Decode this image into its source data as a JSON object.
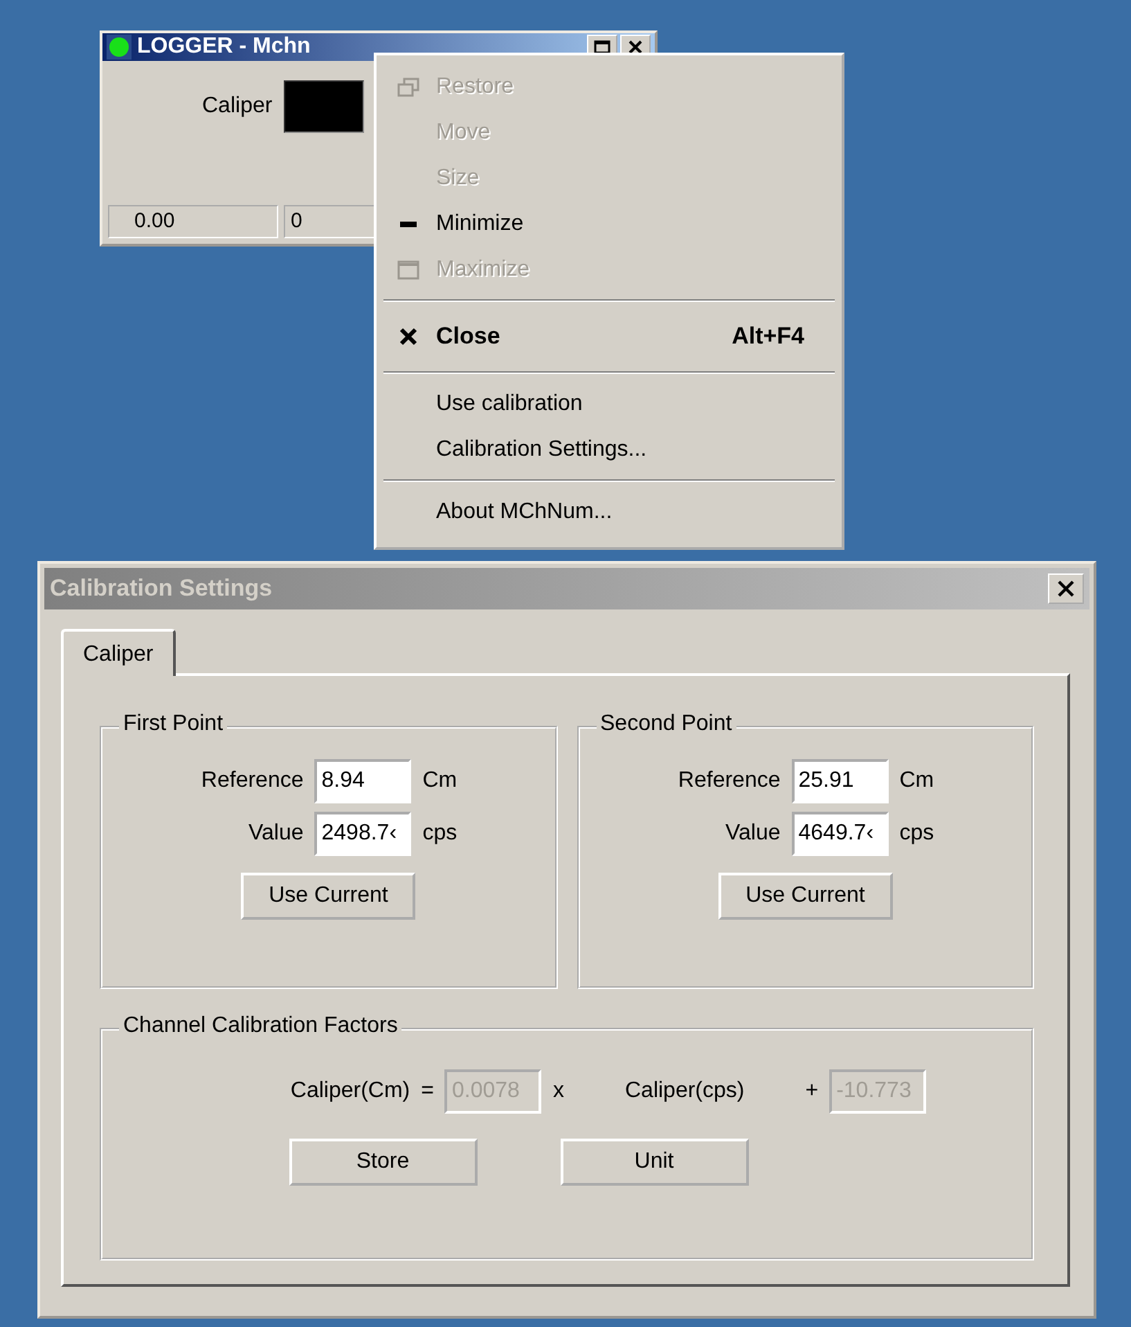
{
  "logger_window": {
    "title": "LOGGER - Mchn",
    "active": true,
    "label": "Caliper",
    "status_fields": [
      "0.00",
      "0"
    ]
  },
  "system_menu": {
    "items": [
      {
        "kind": "item",
        "label": "Restore",
        "disabled": true,
        "default": false
      },
      {
        "kind": "item",
        "label": "Move",
        "disabled": true,
        "default": false
      },
      {
        "kind": "item",
        "label": "Size",
        "disabled": true,
        "default": false
      },
      {
        "kind": "item",
        "label": "Minimize",
        "disabled": false,
        "default": false
      },
      {
        "kind": "item",
        "label": "Maximize",
        "disabled": true,
        "default": false
      },
      {
        "kind": "separator"
      },
      {
        "kind": "item",
        "label": "Close",
        "shortcut": "Alt+F4",
        "disabled": false,
        "default": true
      },
      {
        "kind": "separator"
      },
      {
        "kind": "item",
        "label": "Use calibration",
        "disabled": false,
        "default": false
      },
      {
        "kind": "item",
        "label": "Calibration Settings...",
        "disabled": false,
        "default": false
      },
      {
        "kind": "separator"
      },
      {
        "kind": "item",
        "label": "About MChNum...",
        "disabled": false,
        "default": false
      }
    ]
  },
  "calibration_window": {
    "title": "Calibration Settings",
    "active": false,
    "tabs": [
      {
        "label": "Caliper",
        "selected": true
      }
    ],
    "points": [
      {
        "title": "First Point",
        "fields": [
          {
            "label": "Reference",
            "value": "8.94",
            "unit": "Cm"
          },
          {
            "label": "Value",
            "value": "2498.7‹",
            "unit": "cps"
          }
        ],
        "button": "Use Current"
      },
      {
        "title": "Second Point",
        "fields": [
          {
            "label": "Reference",
            "value": "25.91",
            "unit": "Cm"
          },
          {
            "label": "Value",
            "value": "4649.7‹",
            "unit": "cps"
          }
        ],
        "button": "Use Current"
      }
    ],
    "factors": {
      "title": "Channel Calibration Factors",
      "lhs": "Caliper(Cm)",
      "equals": "=",
      "slope": {
        "value": "0.0078",
        "disabled": true
      },
      "times": "x",
      "variable": "Caliper(cps)",
      "plus": "+",
      "offset": {
        "value": "-10.773",
        "disabled": true
      },
      "buttons": [
        "Store",
        "Unit"
      ]
    }
  }
}
